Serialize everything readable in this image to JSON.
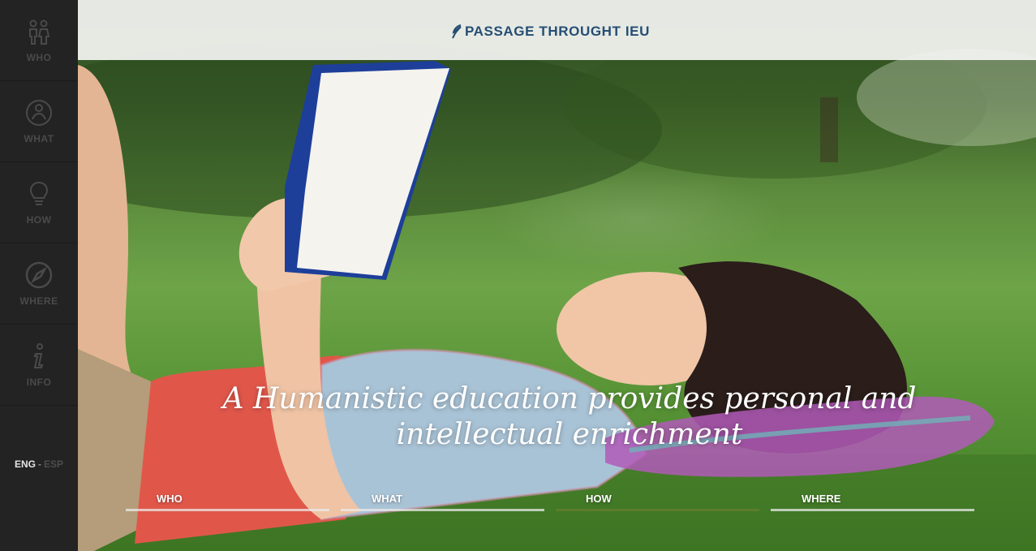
{
  "sidebar": {
    "items": [
      {
        "label": "WHO",
        "icon": "people-icon"
      },
      {
        "label": "WHAT",
        "icon": "person-circle-icon"
      },
      {
        "label": "HOW",
        "icon": "lightbulb-icon"
      },
      {
        "label": "WHERE",
        "icon": "compass-icon"
      },
      {
        "label": "INFO",
        "icon": "info-icon"
      }
    ],
    "languages": {
      "active": "ENG",
      "separator": "-",
      "other": "ESP"
    }
  },
  "header": {
    "brand": "PASSAGE THROUGHT IEU",
    "logo_icon": "feather-logo-icon",
    "brand_color": "#254d74"
  },
  "hero": {
    "headline": "A Humanistic education provides personal and intellectual enrichment",
    "image": "woman-reading-book-on-grass"
  },
  "sections": [
    {
      "label": "WHO",
      "progress": 0
    },
    {
      "label": "WHAT",
      "progress": 0
    },
    {
      "label": "HOW",
      "progress": 1.0
    },
    {
      "label": "WHERE",
      "progress": 0
    }
  ],
  "colors": {
    "sidebar_bg": "#232323",
    "accent_green": "#5d7c2c"
  }
}
